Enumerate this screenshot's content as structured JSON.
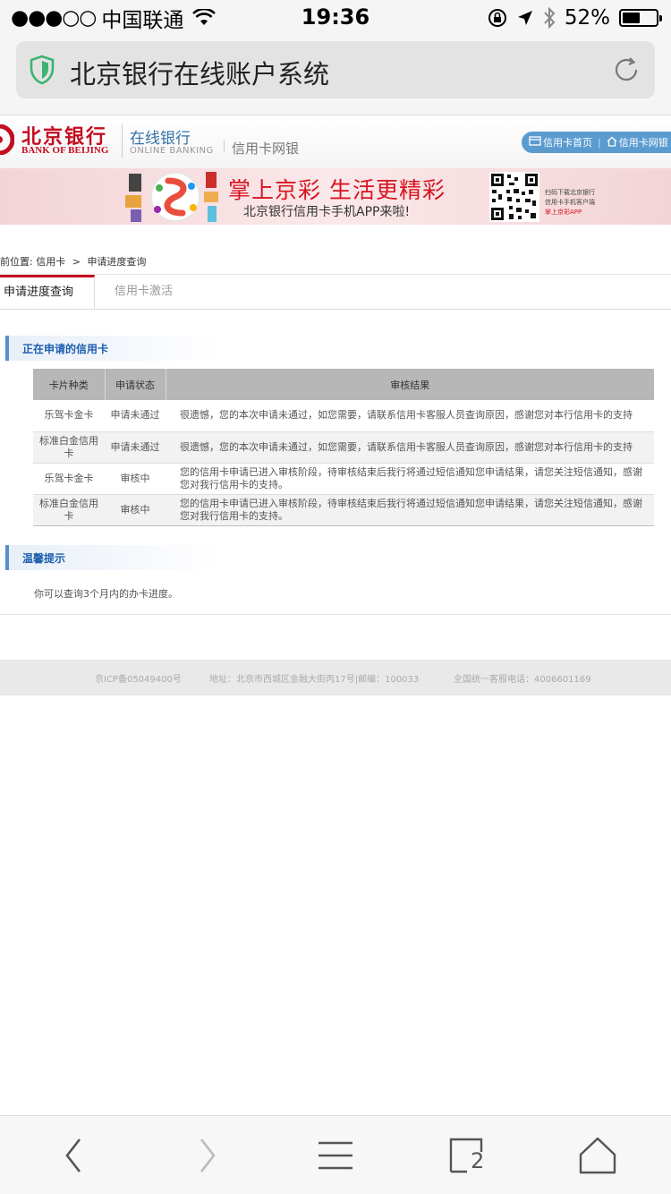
{
  "status_bar": {
    "signal": "●●●○○",
    "carrier": "中国联通",
    "time": "19:36",
    "battery_percent_label": "52%",
    "battery_level": 0.52
  },
  "browser": {
    "page_title": "北京银行在线账户系统"
  },
  "bank_header": {
    "logo_cn": "北京银行",
    "logo_en": "BANK OF BEIJING",
    "online_cn": "在线银行",
    "online_en": "ONLINE BANKING",
    "section_title": "信用卡网银",
    "nav_home": "信用卡首页",
    "nav_second": "信用卡网银"
  },
  "banner": {
    "headline": "掌上京彩 生活更精彩",
    "subline": "北京银行信用卡手机APP来啦!",
    "qr_line1": "扫码下载北京银行",
    "qr_line2": "信用卡手机客户端",
    "qr_line3": "掌上京彩APP"
  },
  "breadcrumb": {
    "prefix": "前位置:",
    "item1": "信用卡",
    "separator": ">",
    "item2": "申请进度查询"
  },
  "tabs": [
    {
      "label": "申请进度查询",
      "active": true
    },
    {
      "label": "信用卡激活",
      "active": false
    }
  ],
  "applying_section": {
    "title": "正在申请的信用卡",
    "headers": [
      "卡片种类",
      "申请状态",
      "审核结果"
    ],
    "rows": [
      {
        "card": "乐驾卡金卡",
        "status": "申请未通过",
        "result": "很遗憾，您的本次申请未通过，如您需要，请联系信用卡客服人员查询原因，感谢您对本行信用卡的支持"
      },
      {
        "card": "标准白金信用卡",
        "status": "申请未通过",
        "result": "很遗憾，您的本次申请未通过，如您需要，请联系信用卡客服人员查询原因，感谢您对本行信用卡的支持"
      },
      {
        "card": "乐驾卡金卡",
        "status": "审核中",
        "result": "您的信用卡申请已进入审核阶段，待审核结束后我行将通过短信通知您申请结果，请您关注短信通知，感谢您对我行信用卡的支持。"
      },
      {
        "card": "标准白金信用卡",
        "status": "审核中",
        "result": "您的信用卡申请已进入审核阶段，待审核结束后我行将通过短信通知您申请结果，请您关注短信通知，感谢您对我行信用卡的支持。"
      }
    ]
  },
  "tips_section": {
    "title": "温馨提示",
    "text": "你可以查询3个月内的办卡进度。"
  },
  "footer": {
    "icp": "京ICP备05049400号",
    "address": "地址：北京市西城区金融大街丙17号|邮编：100033",
    "hotline": "全国统一客服电话：4006601169"
  },
  "toolbar": {
    "tab_count": "2"
  },
  "colors": {
    "brand_red": "#c40d20",
    "link_blue": "#1d5fae",
    "secure_green": "#3cb371"
  }
}
